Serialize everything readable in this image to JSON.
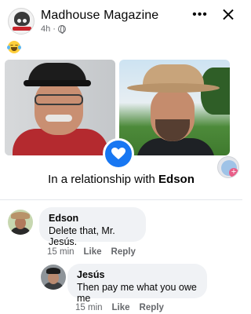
{
  "header": {
    "page_name": "Madhouse Magazine",
    "time": "4h",
    "privacy_icon": "globe-icon",
    "more_icon": "more-icon",
    "close_icon": "close-icon"
  },
  "post": {
    "caption_emoji": "face-with-tears-of-joy",
    "image": {
      "relationship_prefix": "In a relationship with",
      "relationship_name": "Edson",
      "badge_icon": "heart-icon",
      "badge_color": "#1877f2"
    }
  },
  "comments": [
    {
      "author": "Edson",
      "text": "Delete that, Mr. Jesús.",
      "time": "15 min",
      "like_label": "Like",
      "reply_label": "Reply"
    },
    {
      "author": "Jesús",
      "text": "Then pay me what you owe me",
      "time": "15 min",
      "like_label": "Like",
      "reply_label": "Reply"
    }
  ]
}
